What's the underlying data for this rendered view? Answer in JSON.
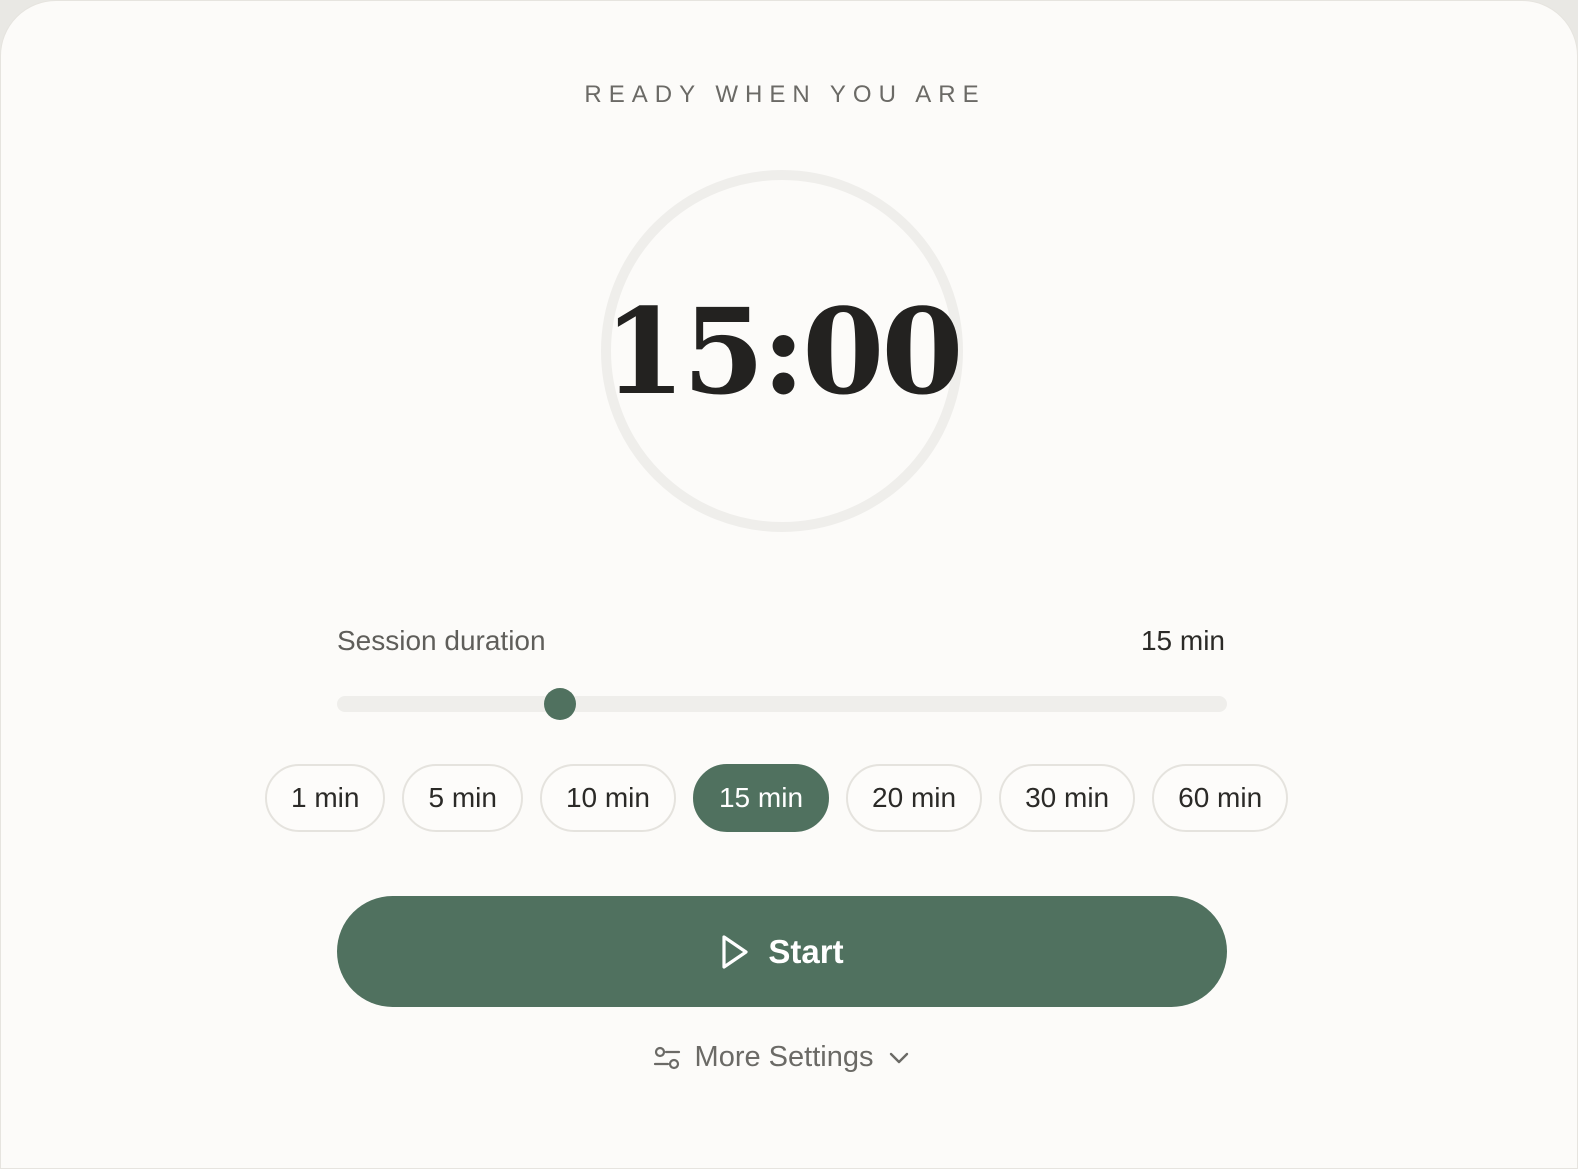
{
  "header": {
    "eyebrow": "READY WHEN YOU ARE"
  },
  "timer": {
    "display": "15:00"
  },
  "duration": {
    "label": "Session duration",
    "value_label": "15 min",
    "slider_fraction": 0.25
  },
  "presets": [
    {
      "label": "1 min",
      "active": false
    },
    {
      "label": "5 min",
      "active": false
    },
    {
      "label": "10 min",
      "active": false
    },
    {
      "label": "15 min",
      "active": true
    },
    {
      "label": "20 min",
      "active": false
    },
    {
      "label": "30 min",
      "active": false
    },
    {
      "label": "60 min",
      "active": false
    }
  ],
  "actions": {
    "start_label": "Start",
    "start_icon": "play-icon",
    "more_settings_label": "More Settings",
    "more_settings_icon": "sliders-icon",
    "expand_icon": "chevron-down-icon"
  },
  "colors": {
    "accent": "#50715f",
    "background": "#fcfbf9",
    "text": "#2b2a27",
    "muted": "#6b6a66"
  }
}
